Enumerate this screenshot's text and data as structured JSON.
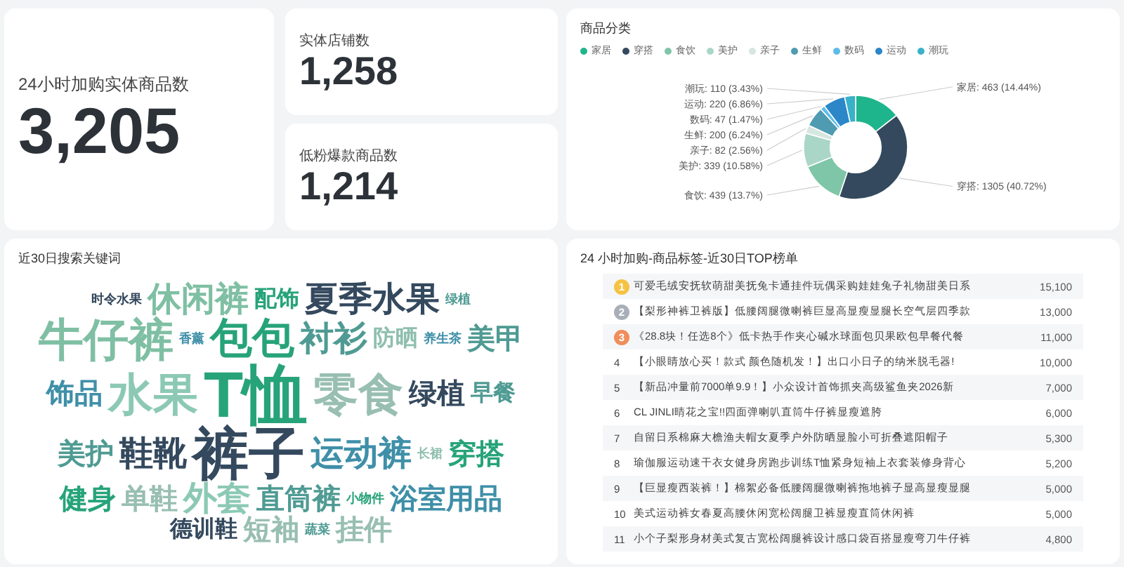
{
  "stats": [
    {
      "kind": "large",
      "label": "24小时加购实体商品数",
      "value": "3,205"
    },
    {
      "kind": "small",
      "label": "实体店铺数",
      "value": "1,258"
    },
    {
      "kind": "small",
      "label": "低粉爆款商品数",
      "value": "1,214"
    }
  ],
  "category_chart": {
    "title": "商品分类",
    "legend": [
      {
        "color": "#1fb58c"
      },
      {
        "color": "#34495e"
      },
      {
        "color": "#7fc6a8"
      },
      {
        "color": "#a9d6c7"
      },
      {
        "color": "#d6e6e1"
      },
      {
        "color": "#4f9bb1"
      },
      {
        "color": "#5dbde8"
      },
      {
        "color": "#2b87c8"
      },
      {
        "color": "#39b2c9"
      }
    ],
    "chart_data": {
      "type": "donut",
      "categories": [
        "家居",
        "穿搭",
        "食饮",
        "美护",
        "亲子",
        "生鲜",
        "数码",
        "运动",
        "潮玩"
      ],
      "values": [
        463,
        1305,
        439,
        339,
        82,
        200,
        47,
        220,
        110
      ],
      "data_labels": true,
      "value_labels": [
        "家居: 463 (14.44%)",
        "穿搭: 1305 (40.72%)",
        "食饮: 439 (13.7%)",
        "美护: 339 (10.58%)",
        "亲子: 82 (2.56%)",
        "生鲜: 200 (6.24%)",
        "数码: 47 (1.47%)",
        "运动: 220 (6.86%)",
        "潮玩: 110 (3.43%)"
      ]
    }
  },
  "word_cloud": {
    "title": "近30日搜索关键词",
    "words": [
      {
        "text": "时令水果",
        "kind": "xs",
        "color": "#34495e"
      },
      {
        "text": "休闲裤",
        "kind": "l",
        "color": "#7fbfa3"
      },
      {
        "text": "配饰",
        "kind": "s",
        "color": "#27a37a"
      },
      {
        "text": "夏季水果",
        "kind": "l",
        "color": "#34495e"
      },
      {
        "text": "绿植",
        "kind": "xs",
        "color": "#4f9b93"
      },
      {
        "text": "牛仔裤",
        "kind": "xxl",
        "color": "#7fbfa3"
      },
      {
        "text": "香薰",
        "kind": "xs",
        "color": "#3f8fa8"
      },
      {
        "text": "包包",
        "kind": "xl",
        "color": "#27a37a"
      },
      {
        "text": "衬衫",
        "kind": "l",
        "color": "#4f9b93"
      },
      {
        "text": "防晒",
        "kind": "s",
        "color": "#8fbfae"
      },
      {
        "text": "养生茶",
        "kind": "xs",
        "color": "#3f8fa8"
      },
      {
        "text": "美甲",
        "kind": "m",
        "color": "#4f9b93"
      },
      {
        "text": "饰品",
        "kind": "m",
        "color": "#3f8fa8"
      },
      {
        "text": "水果",
        "kind": "xxl",
        "color": "#8cc9b4"
      },
      {
        "text": "T恤",
        "kind": "max",
        "color": "#27a37a"
      },
      {
        "text": "零食",
        "kind": "xxl",
        "color": "#98bfb1"
      },
      {
        "text": "绿植",
        "kind": "m",
        "color": "#34495e"
      },
      {
        "text": "早餐",
        "kind": "s",
        "color": "#4f9b93"
      },
      {
        "text": "美护",
        "kind": "m",
        "color": "#4f9b93"
      },
      {
        "text": "鞋靴",
        "kind": "l",
        "color": "#34495e"
      },
      {
        "text": "裤子",
        "kind": "huge",
        "color": "#34495e"
      },
      {
        "text": "运动裤",
        "kind": "l",
        "color": "#3f8fa8"
      },
      {
        "text": "长裙",
        "kind": "xs",
        "color": "#8fbfae"
      },
      {
        "text": "穿搭",
        "kind": "m",
        "color": "#27a37a"
      },
      {
        "text": "健身",
        "kind": "m",
        "color": "#27a37a"
      },
      {
        "text": "单鞋",
        "kind": "m",
        "color": "#98bfb1"
      },
      {
        "text": "外套",
        "kind": "l",
        "color": "#8cc9b4"
      },
      {
        "text": "直筒裤",
        "kind": "m",
        "color": "#4f9b93"
      },
      {
        "text": "小物件",
        "kind": "xs",
        "color": "#27a37a"
      },
      {
        "text": "浴室用品",
        "kind": "m",
        "color": "#3f8fa8"
      },
      {
        "text": "德训鞋",
        "kind": "s",
        "color": "#34495e"
      },
      {
        "text": "短袖",
        "kind": "m",
        "color": "#98bfb1"
      },
      {
        "text": "蔬菜",
        "kind": "xs",
        "color": "#4f9b93"
      },
      {
        "text": "挂件",
        "kind": "m",
        "color": "#98bfb1"
      }
    ]
  },
  "top_list": {
    "title": "24 小时加购-商品标签-近30日TOP榜单",
    "rows": [
      {
        "rank": "1",
        "kind": "medal",
        "color": "#f5c242",
        "title": "可爱毛绒安抚软萌甜美抚兔卡通挂件玩偶采购娃娃兔子礼物甜美日系",
        "value": "15,100"
      },
      {
        "rank": "2",
        "kind": "medal",
        "color": "#a9afb8",
        "title": "【梨形神裤卫裤版】低腰阔腿微喇裤巨显高显瘦显腿长空气层四季款",
        "value": "13,000"
      },
      {
        "rank": "3",
        "kind": "medal",
        "color": "#f08d5a",
        "title": "《28.8块！任选8个》低卡热手作夹心碱水球面包贝果欧包早餐代餐",
        "value": "11,000"
      },
      {
        "rank": "4",
        "kind": "plain",
        "title": "【小眼睛放心买！款式 颜色随机发！】出口小日子的纳米脱毛器!",
        "value": "10,000"
      },
      {
        "rank": "5",
        "kind": "plain",
        "title": "【新品冲量前7000单9.9！】小众设计首饰抓夹高级鲨鱼夹2026新",
        "value": "7,000"
      },
      {
        "rank": "6",
        "kind": "plain",
        "title": "CL JINLI晴花之宝!!四面弹喇叭直筒牛仔裤显瘦遮胯",
        "value": "6,000"
      },
      {
        "rank": "7",
        "kind": "plain",
        "title": "自留日系棉麻大檐渔夫帽女夏季户外防晒显脸小可折叠遮阳帽子",
        "value": "5,300"
      },
      {
        "rank": "8",
        "kind": "plain",
        "title": "瑜伽服运动速干衣女健身房跑步训练T恤紧身短袖上衣套装修身背心",
        "value": "5,200"
      },
      {
        "rank": "9",
        "kind": "plain",
        "title": "【巨显瘦西装裤！】棉絮必备低腰阔腿微喇裤拖地裤子显高显瘦显腿",
        "value": "5,000"
      },
      {
        "rank": "10",
        "kind": "plain",
        "title": "美式运动裤女春夏高腰休闲宽松阔腿卫裤显瘦直筒休闲裤",
        "value": "5,000"
      },
      {
        "rank": "11",
        "kind": "plain",
        "title": "小个子梨形身材美式复古宽松阔腿裤设计感口袋百搭显瘦弯刀牛仔裤",
        "value": "4,800"
      }
    ]
  }
}
